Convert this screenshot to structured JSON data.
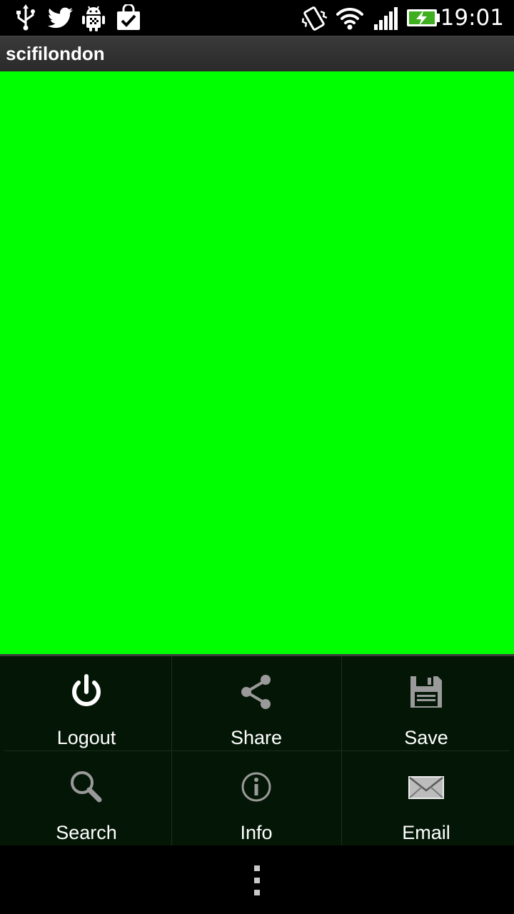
{
  "status_bar": {
    "time": "19:01",
    "left_icons": [
      "usb-icon",
      "twitter-icon",
      "android-debug-icon",
      "market-update-icon"
    ],
    "right_icons": [
      "vibrate-icon",
      "wifi-icon",
      "signal-icon",
      "battery-charging-icon"
    ]
  },
  "title_bar": {
    "title": "scifilondon"
  },
  "content": {
    "background_color": "#00ff00"
  },
  "menu": {
    "items": [
      {
        "label": "Logout",
        "icon": "power-icon"
      },
      {
        "label": "Share",
        "icon": "share-icon"
      },
      {
        "label": "Save",
        "icon": "floppy-disk-icon"
      },
      {
        "label": "Search",
        "icon": "search-icon"
      },
      {
        "label": "Info",
        "icon": "info-icon"
      },
      {
        "label": "Email",
        "icon": "envelope-icon"
      }
    ]
  },
  "nav_bar": {
    "icon": "overflow-menu-icon"
  }
}
